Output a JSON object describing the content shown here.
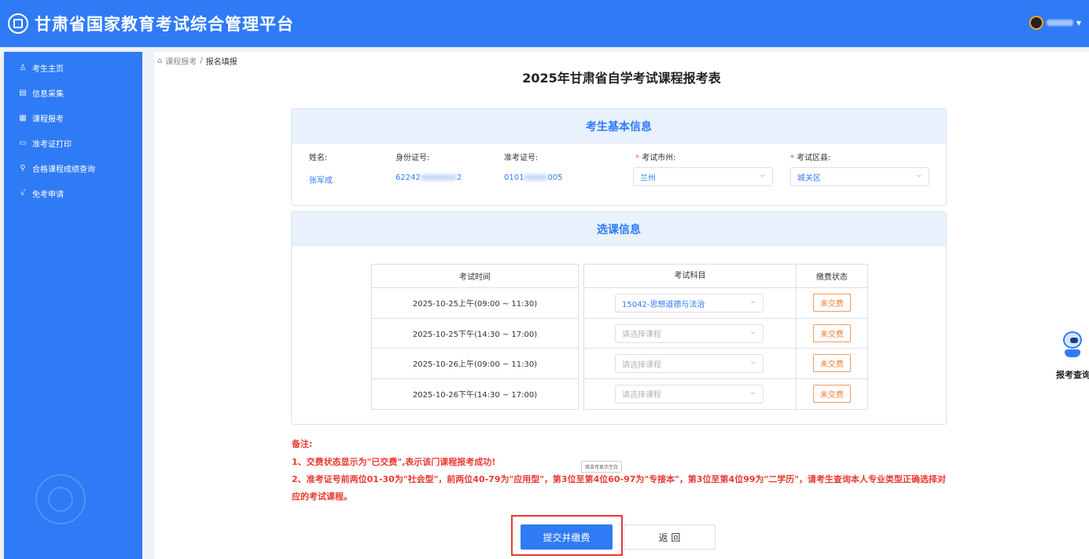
{
  "header": {
    "title": "甘肃省国家教育考试综合管理平台"
  },
  "sidebar": {
    "items": [
      {
        "label": "考生主页",
        "icon": "user-icon"
      },
      {
        "label": "信息采集",
        "icon": "form-icon"
      },
      {
        "label": "课程报考",
        "icon": "list-icon"
      },
      {
        "label": "准考证打印",
        "icon": "card-icon"
      },
      {
        "label": "合格课程成绩查询",
        "icon": "search-icon"
      },
      {
        "label": "免考申请",
        "icon": "check-icon"
      }
    ]
  },
  "breadcrumb": {
    "parent": "课程报考",
    "separator": "/",
    "current": "报名填报"
  },
  "form": {
    "title": "2025年甘肃省自学考试课程报考表",
    "basic_info": {
      "heading": "考生基本信息",
      "name_label": "姓名:",
      "name_value": "张军成",
      "id_label": "身份证号:",
      "id_prefix": "62242",
      "id_suffix": "2",
      "ticket_label": "准考证号:",
      "ticket_prefix": "0101",
      "ticket_suffix": "005",
      "city_label": "考试市州:",
      "city_value": "兰州",
      "district_label": "考试区县:",
      "district_value": "城关区",
      "required_mark": "*"
    },
    "course_info": {
      "heading": "选课信息",
      "columns": [
        "考试时间",
        "考试科目",
        "缴费状态"
      ],
      "rows": [
        {
          "time": "2025-10-25上午(09:00 ~ 11:30)",
          "subject": "15042-思想道德与法治",
          "status": "未交费"
        },
        {
          "time": "2025-10-25下午(14:30 ~ 17:00)",
          "subject": "请选择课程",
          "status": "未交费"
        },
        {
          "time": "2025-10-26上午(09:00 ~ 11:30)",
          "subject": "请选择课程",
          "status": "未交费"
        },
        {
          "time": "2025-10-26下午(14:30 ~ 17:00)",
          "subject": "请选择课程",
          "status": "未交费"
        }
      ]
    }
  },
  "notes": {
    "title": "备注:",
    "line1": "1、交费状态显示为\"已交费\",表示该门课程报考成功!",
    "line2": "2、准考证号前两位01-30为\"社会型\"，前两位40-79为\"应用型\"，第3位至第4位60-97为\"专接本\"，第3位至第4位99为\"二学历\"，请考生查询本人专业类型正确选择对应的考试课程。"
  },
  "tooltip": "双击可显示空白",
  "buttons": {
    "submit": "提交并缴费",
    "back": "返 回"
  },
  "float_widget": {
    "label": "报考查询"
  },
  "colors": {
    "primary": "#2f7bf5",
    "danger": "#e83a33",
    "warning": "#f07b32"
  }
}
